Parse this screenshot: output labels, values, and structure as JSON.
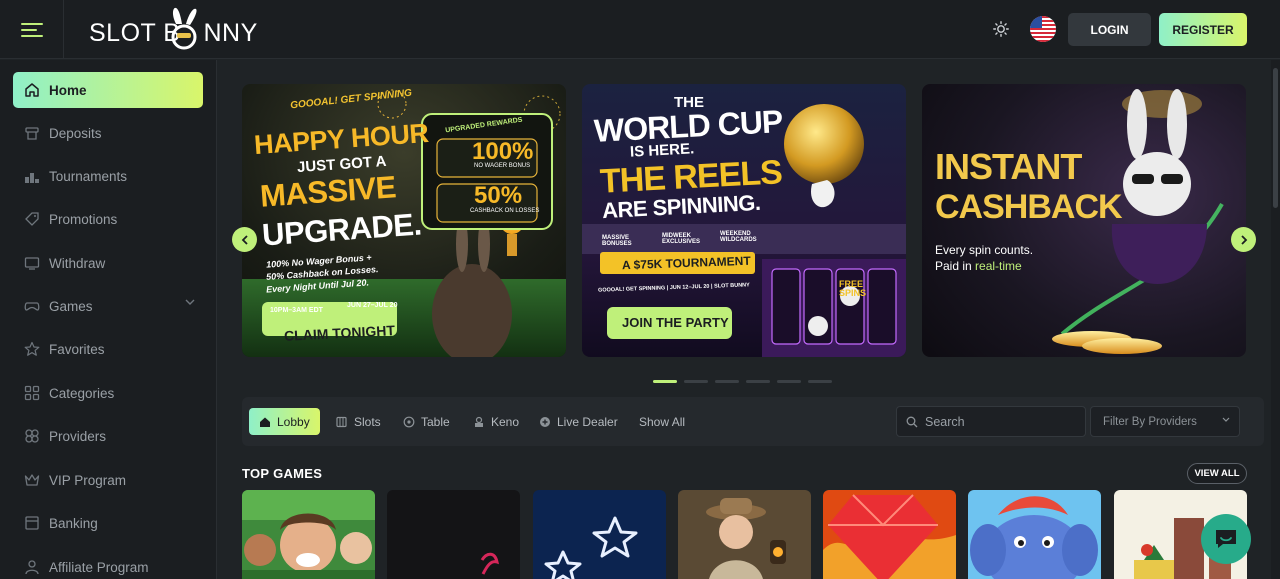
{
  "header": {
    "logo_text_left": "SLOT B",
    "logo_text_right": "NNY",
    "login_label": "LOGIN",
    "register_label": "REGISTER"
  },
  "sidebar": {
    "items": [
      {
        "label": "Home",
        "icon": "home-icon",
        "active": true
      },
      {
        "label": "Deposits",
        "icon": "deposit-icon"
      },
      {
        "label": "Tournaments",
        "icon": "tournament-icon"
      },
      {
        "label": "Promotions",
        "icon": "tag-icon"
      },
      {
        "label": "Withdraw",
        "icon": "wallet-icon"
      },
      {
        "label": "Games",
        "icon": "gamepad-icon",
        "expandable": true
      },
      {
        "label": "Favorites",
        "icon": "star-icon"
      },
      {
        "label": "Categories",
        "icon": "grid-icon"
      },
      {
        "label": "Providers",
        "icon": "providers-icon"
      },
      {
        "label": "VIP Program",
        "icon": "crown-icon"
      },
      {
        "label": "Banking",
        "icon": "bank-icon"
      },
      {
        "label": "Affiliate Program",
        "icon": "affiliate-icon"
      }
    ]
  },
  "banners": [
    {
      "kicker": "GOOOAL! GET SPINNING",
      "title_lines": [
        "HAPPY HOUR",
        "JUST GOT A",
        "MASSIVE",
        "UPGRADE."
      ],
      "box_title": "UPGRADED REWARDS",
      "box_value_1": "100%",
      "box_caption_1": "NO WAGER BONUS",
      "box_value_2": "50%",
      "box_caption_2": "CASHBACK ON LOSSES",
      "body_lines": [
        "100% No Wager Bonus +",
        "50% Cashback on Losses.",
        "Every Night Until Jul 20."
      ],
      "time_pill": "10PM–3AM EDT",
      "date_pill": "JUN 27–JUL 20",
      "cta": "CLAIM TONIGHT"
    },
    {
      "title_lines": [
        "THE",
        "WORLD CUP",
        "IS HERE.",
        "THE REELS",
        "ARE SPINNING."
      ],
      "features": [
        "MASSIVE BONUSES",
        "MIDWEEK EXCLUSIVES",
        "WEEKEND WILDCARDS"
      ],
      "tournament": "A $75K TOURNAMENT",
      "footer": "GOOOAL! GET SPINNING | JUN 12–JUL 20 | SLOT BUNNY",
      "free_spins": "FREE SPINS",
      "cta": "JOIN THE PARTY"
    },
    {
      "title_lines": [
        "INSTANT",
        "CASHBACK"
      ],
      "sub_line_1": "Every spin counts.",
      "sub_line_2_prefix": "Paid in ",
      "sub_line_2_highlight": "real-time"
    }
  ],
  "carousel": {
    "slides": 6,
    "active": 0
  },
  "filter": {
    "tabs": [
      {
        "label": "Lobby",
        "icon": "lobby-icon",
        "active": true
      },
      {
        "label": "Slots",
        "icon": "slots-icon"
      },
      {
        "label": "Table",
        "icon": "table-icon"
      },
      {
        "label": "Keno",
        "icon": "keno-icon"
      },
      {
        "label": "Live Dealer",
        "icon": "live-dealer-icon"
      },
      {
        "label": "Show All"
      }
    ],
    "search_placeholder": "Search",
    "provider_label": "Filter By Providers"
  },
  "top_games": {
    "title": "TOP GAMES",
    "view_all": "VIEW ALL"
  },
  "colors": {
    "accent_start": "#8ff0c8",
    "accent_end": "#d9f56a",
    "bg": "#1f2326",
    "panel": "#1b1e21",
    "chat": "#27ab8a"
  }
}
